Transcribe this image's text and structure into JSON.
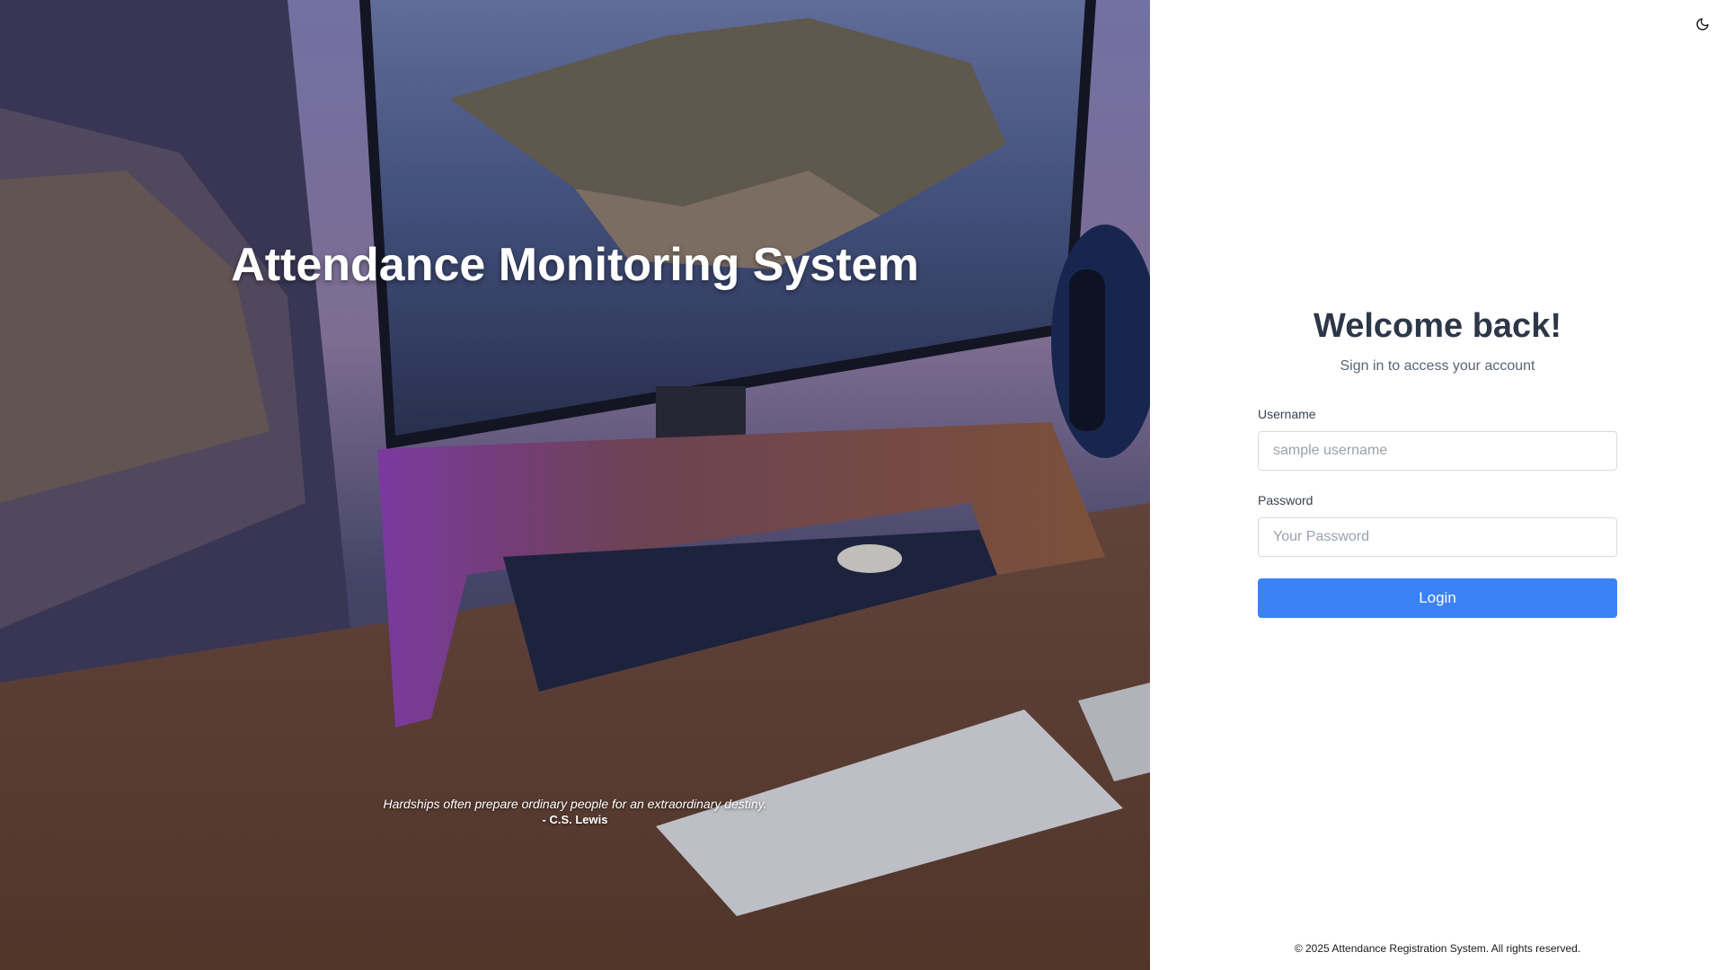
{
  "hero": {
    "title": "Attendance Monitoring System",
    "quote": {
      "text": "Hardships often prepare ordinary people for an extraordinary destiny.",
      "author": "- C.S. Lewis"
    }
  },
  "theme_toggle": {
    "icon": "moon-icon"
  },
  "login": {
    "heading": "Welcome back!",
    "subtitle": "Sign in to access your account",
    "username": {
      "label": "Username",
      "placeholder": "sample username",
      "value": ""
    },
    "password": {
      "label": "Password",
      "placeholder": "Your Password",
      "value": ""
    },
    "button_label": "Login"
  },
  "footer": {
    "text": "© 2025 Attendance Registration System. All rights reserved."
  },
  "colors": {
    "accent": "#3b82f6",
    "heading": "#2d3748"
  }
}
